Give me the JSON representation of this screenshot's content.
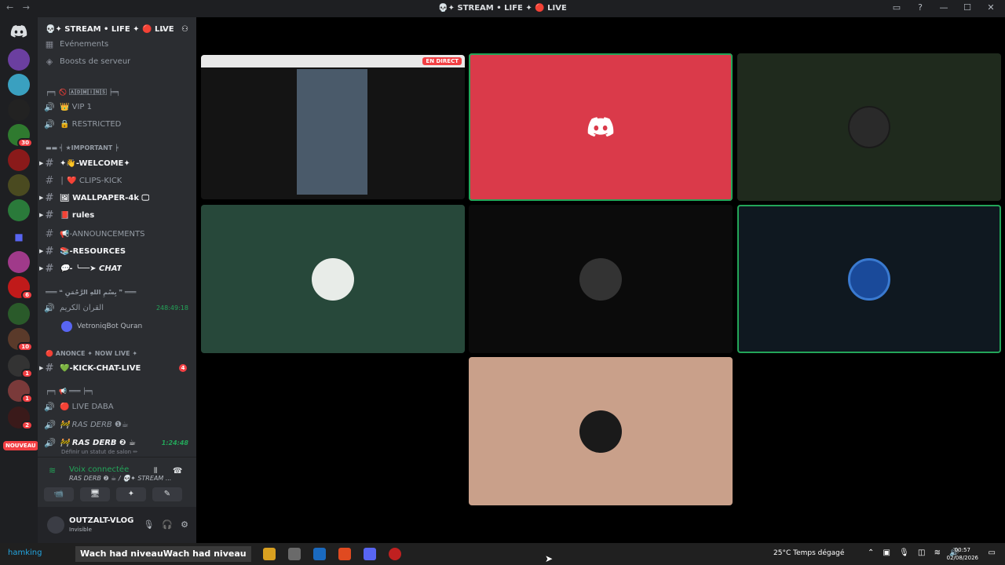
{
  "window": {
    "title": "💀✦ STREAM • LIFE ✦ 🔴 LIVE",
    "nav_back": "←",
    "nav_forward": "→"
  },
  "server": {
    "name": "💀✦ STREAM • LIFE ✦ 🔴 LIVE",
    "chevron": "⌄",
    "invite_icon": "person-add-icon"
  },
  "guild_badges": [
    "30",
    "6",
    "10",
    "1",
    "1",
    "2"
  ],
  "nouveau_label": "NOUVEAU",
  "channels": {
    "events": "Événements",
    "boosts": "Boosts de serveur",
    "cat1": "╒═╕ 🚫 🄰🄳🄼🄸🄽🅂 ╞═╕",
    "vip": "👑 VIP 1",
    "restricted": "🔒 RESTRICTED",
    "cat_important": "▬▬ ╡ ★IMPORTANT ╞",
    "welcome": "✦👋-WELCOME✦",
    "clips": "│ ❤️ CLIPS-KICK",
    "wallpaper": "🖼 WALLPAPER-4k 🖵",
    "rules": "📕 rules",
    "announcements": "📢-ANNOUNCEMENTS",
    "resources": "📚-RESOURCES",
    "chat": "💬- ╰──➤ CHAT",
    "cat_quran": "═══ ❝ بِسْمِ اللهِ الرَّحْمَنِ ❞ ═══",
    "quran": "القرآن الكريم",
    "quran_time": "248:49:18",
    "bot_name": "VetroniqBot Quran",
    "cat_live": "🔴 ANONCE ✦ NOW LIVE ✦",
    "kick_chat": "💚-KICK-CHAT-LIVE",
    "kick_badge": "4",
    "cat_voice": "╒═╕ 📢 ═══ ╞═╕",
    "live_daba": "🔴 LIVE DABA",
    "ras_derb1": "🚧 RAS DERB ❶☕",
    "ras_derb2": "🚧 RAS DERB ❷ ☕",
    "ras_time": "1:24:48",
    "set_status": "Définir un statut de salon ✏"
  },
  "voice_panel": {
    "connected": "Voix connectée",
    "channel": "RAS DERB ❷ ☕ / 💀✦ STREAM ...",
    "buttons": [
      "📹",
      "🖥",
      "✦",
      "✎"
    ]
  },
  "user": {
    "name": "OUTZALT-VLOG",
    "status": "Invisible"
  },
  "stage": {
    "live_label": "EN DIRECT"
  },
  "taskbar": {
    "ticker": "Wach had niveauWach had niveau",
    "ticker_prefix": "hamking",
    "weather": "25°C  Temps dégagé",
    "time": "00:57",
    "date": "02/08/2026"
  },
  "colors": {
    "discord_red": "#da3a4a",
    "tile_green": "#1f2a1d",
    "tile_teal": "#27483a",
    "tile_navy": "#0f1820",
    "tile_peach": "#c9a08a",
    "speaking": "#23a559"
  }
}
